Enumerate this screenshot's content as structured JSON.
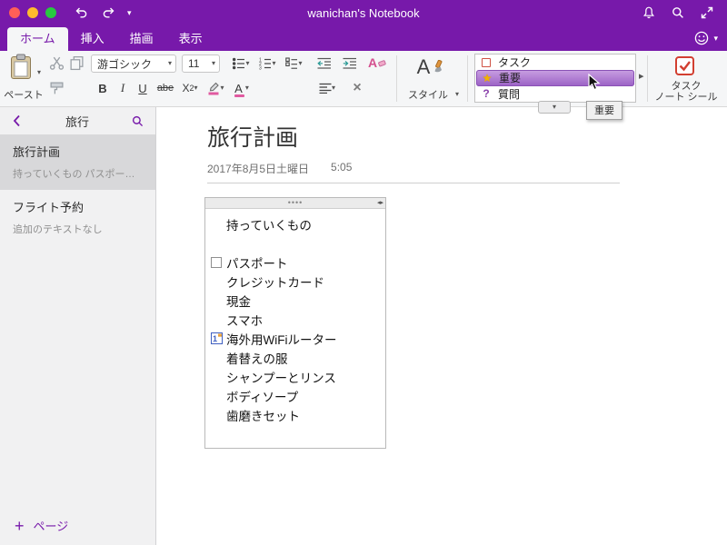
{
  "titlebar": {
    "title": "wanichan's Notebook"
  },
  "tabs": {
    "home": "ホーム",
    "insert": "挿入",
    "draw": "描画",
    "view": "表示"
  },
  "ribbon": {
    "paste_label": "ペースト",
    "font_name": "游ゴシック",
    "font_size": "11",
    "styles_label": "スタイル",
    "tags": [
      {
        "label": "タスク"
      },
      {
        "label": "重要"
      },
      {
        "label": "質問"
      }
    ],
    "tag_tooltip": "重要",
    "task_seal_line1": "タスク",
    "task_seal_line2": "ノート シール"
  },
  "sidebar": {
    "section_title": "旅行",
    "pages": [
      {
        "title": "旅行計画",
        "subtitle": "持っていくもの パスポー…"
      },
      {
        "title": "フライト予約",
        "subtitle": "追加のテキストなし"
      }
    ],
    "add_page_label": "ページ"
  },
  "content": {
    "title": "旅行計画",
    "date": "2017年8月5日土曜日",
    "time": "5:05",
    "items": [
      {
        "text": "持っていくもの"
      },
      {
        "text": "パスポート"
      },
      {
        "text": "クレジットカード"
      },
      {
        "text": "現金"
      },
      {
        "text": "スマホ"
      },
      {
        "text": "海外用WiFiルーター"
      },
      {
        "text": "着替えの服"
      },
      {
        "text": "シャンプーとリンス"
      },
      {
        "text": "ボディソープ"
      },
      {
        "text": "歯磨きセット"
      }
    ]
  },
  "glyphs": {
    "chevron_down": "▾",
    "scroll_right": "▸",
    "star": "★",
    "question": "?",
    "plus": "+",
    "close_x": "×",
    "grip_dots": "••••",
    "resize_arrows": "◂▸",
    "bold": "B",
    "italic": "I",
    "underline": "U",
    "strike": "abe",
    "sub_x": "X",
    "sub_2": "2",
    "letter_a": "A"
  },
  "colors": {
    "brand_purple": "#7719aa",
    "tag_selection_border": "#8a51b5",
    "task_red": "#d23f31",
    "star_gold": "#f2b200"
  }
}
